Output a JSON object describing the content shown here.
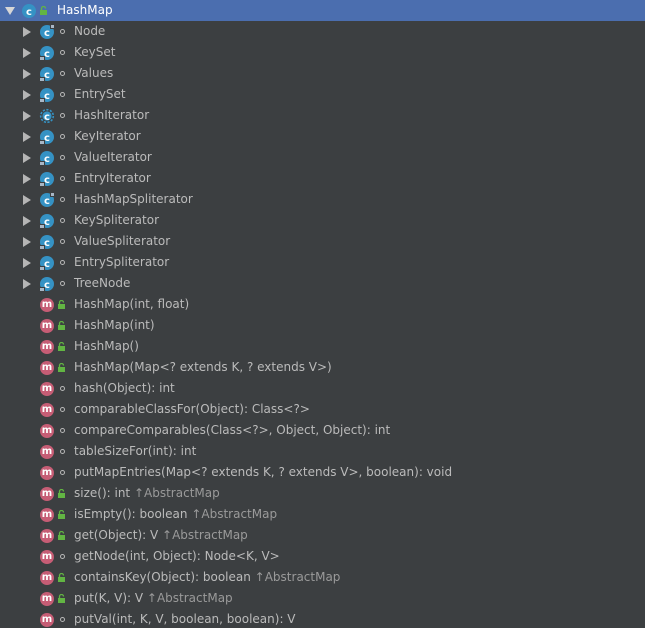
{
  "root": {
    "label": "HashMap",
    "icon": "class-icon",
    "expanded": true
  },
  "nested_classes": [
    {
      "label": "Node",
      "icon": "static-class-icon",
      "visibility": "package"
    },
    {
      "label": "KeySet",
      "icon": "final-class-icon",
      "visibility": "package"
    },
    {
      "label": "Values",
      "icon": "final-class-icon",
      "visibility": "package"
    },
    {
      "label": "EntrySet",
      "icon": "final-class-icon",
      "visibility": "package"
    },
    {
      "label": "HashIterator",
      "icon": "abstract-class-icon",
      "visibility": "package"
    },
    {
      "label": "KeyIterator",
      "icon": "final-class-icon",
      "visibility": "package"
    },
    {
      "label": "ValueIterator",
      "icon": "final-class-icon",
      "visibility": "package"
    },
    {
      "label": "EntryIterator",
      "icon": "final-class-icon",
      "visibility": "package"
    },
    {
      "label": "HashMapSpliterator",
      "icon": "static-class-icon",
      "visibility": "package"
    },
    {
      "label": "KeySpliterator",
      "icon": "final-class-icon",
      "visibility": "package"
    },
    {
      "label": "ValueSpliterator",
      "icon": "final-class-icon",
      "visibility": "package"
    },
    {
      "label": "EntrySpliterator",
      "icon": "final-class-icon",
      "visibility": "package"
    },
    {
      "label": "TreeNode",
      "icon": "final-class-icon",
      "visibility": "package"
    }
  ],
  "methods": [
    {
      "label": "HashMap(int, float)",
      "inherited": "",
      "visibility": "public"
    },
    {
      "label": "HashMap(int)",
      "inherited": "",
      "visibility": "public"
    },
    {
      "label": "HashMap()",
      "inherited": "",
      "visibility": "public"
    },
    {
      "label": "HashMap(Map<? extends K, ? extends V>)",
      "inherited": "",
      "visibility": "public"
    },
    {
      "label": "hash(Object): int",
      "inherited": "",
      "visibility": "package"
    },
    {
      "label": "comparableClassFor(Object): Class<?>",
      "inherited": "",
      "visibility": "package"
    },
    {
      "label": "compareComparables(Class<?>, Object, Object): int",
      "inherited": "",
      "visibility": "package"
    },
    {
      "label": "tableSizeFor(int): int",
      "inherited": "",
      "visibility": "package"
    },
    {
      "label": "putMapEntries(Map<? extends K, ? extends V>, boolean): void",
      "inherited": "",
      "visibility": "package"
    },
    {
      "label": "size(): int",
      "inherited": "↑AbstractMap",
      "visibility": "public"
    },
    {
      "label": "isEmpty(): boolean",
      "inherited": "↑AbstractMap",
      "visibility": "public"
    },
    {
      "label": "get(Object): V",
      "inherited": "↑AbstractMap",
      "visibility": "public"
    },
    {
      "label": "getNode(int, Object): Node<K, V>",
      "inherited": "",
      "visibility": "package"
    },
    {
      "label": "containsKey(Object): boolean",
      "inherited": "↑AbstractMap",
      "visibility": "public"
    },
    {
      "label": "put(K, V): V",
      "inherited": "↑AbstractMap",
      "visibility": "public"
    },
    {
      "label": "putVal(int, K, V, boolean, boolean): V",
      "inherited": "",
      "visibility": "package"
    }
  ],
  "method_icon_letter": "m",
  "colors": {
    "background": "#3c3f41",
    "selection": "#4b6eaf",
    "text": "#bbbbbb",
    "inherited_text": "#9a9a9a",
    "class_icon": "#3592c4",
    "method_icon": "#c65d75",
    "public_lock": "#62b543"
  }
}
